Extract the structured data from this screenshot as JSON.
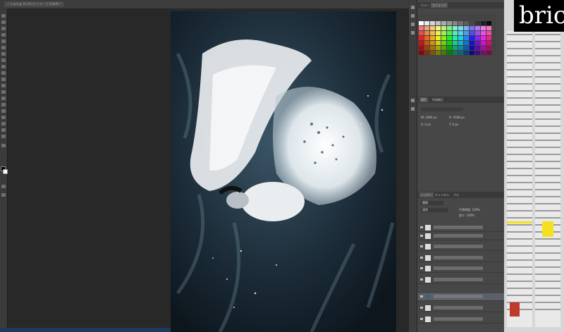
{
  "document": {
    "tab_title": "~ 1 psd @ 33.3% (レイヤー 1, RGB/8) *"
  },
  "panels": {
    "color_tabs": [
      "カラー",
      "スウォッチ"
    ],
    "properties_tabs": [
      "属性",
      "色調補正"
    ],
    "properties_values": [
      "W: 2480 px",
      "H: 3508 px",
      "X: 0 px",
      "Y: 0 px"
    ],
    "layers_tabs": [
      "レイヤー",
      "チャンネル",
      "パス"
    ],
    "layer_filter": "種類",
    "blend_mode": "通常",
    "opacity": "不透明度: 100%",
    "fill": "塗り: 100%"
  },
  "brand": {
    "text": "bric"
  },
  "colors": {
    "photoshop_bg": "#262626",
    "panel_bg": "#474747",
    "selected_layer": "#5c6068",
    "accent_yellow": "#f4e01c"
  }
}
